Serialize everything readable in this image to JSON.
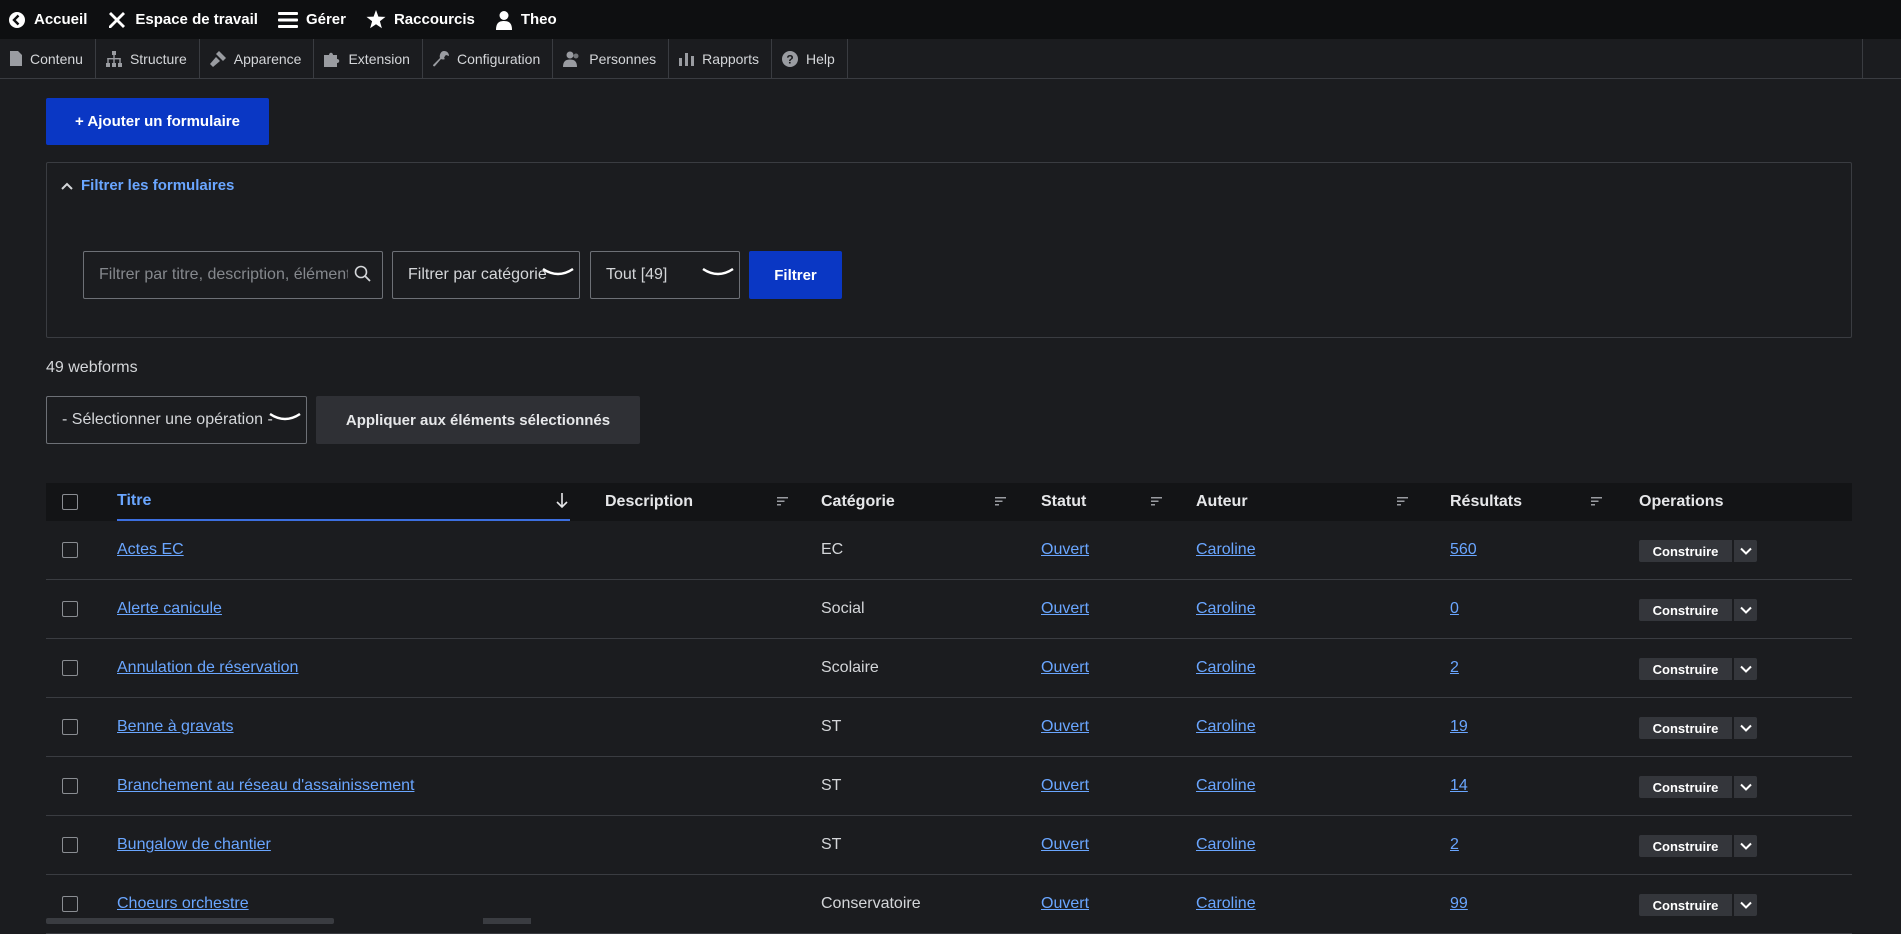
{
  "toolbar": {
    "items": [
      {
        "label": "Accueil",
        "icon": "back-circle-icon"
      },
      {
        "label": "Espace de travail",
        "icon": "tools-icon"
      },
      {
        "label": "Gérer",
        "icon": "menu-icon"
      },
      {
        "label": "Raccourcis",
        "icon": "star-icon"
      },
      {
        "label": "Theo",
        "icon": "user-icon"
      }
    ]
  },
  "admin_menu": {
    "items": [
      {
        "label": "Contenu",
        "icon": "file-icon"
      },
      {
        "label": "Structure",
        "icon": "sitemap-icon"
      },
      {
        "label": "Apparence",
        "icon": "brush-icon"
      },
      {
        "label": "Extension",
        "icon": "puzzle-icon"
      },
      {
        "label": "Configuration",
        "icon": "wrench-icon"
      },
      {
        "label": "Personnes",
        "icon": "people-icon"
      },
      {
        "label": "Rapports",
        "icon": "bar-chart-icon"
      },
      {
        "label": "Help",
        "icon": "question-circle-icon"
      }
    ]
  },
  "add_button": "+ Ajouter un formulaire",
  "filter": {
    "summary": "Filtrer les formulaires",
    "search_placeholder": "Filtrer par titre, description, élément",
    "category_value": "Filtrer par catégorie",
    "state_value": "Tout [49]",
    "submit": "Filtrer"
  },
  "count_text": "49 webforms",
  "bulk": {
    "select_value": "- Sélectionner une opération -",
    "apply": "Appliquer aux éléments sélectionnés"
  },
  "table": {
    "headers": {
      "title": "Titre",
      "description": "Description",
      "category": "Catégorie",
      "status": "Statut",
      "author": "Auteur",
      "results": "Résultats",
      "operations": "Operations"
    },
    "sorted_by": "Titre",
    "rows": [
      {
        "title": "Actes EC",
        "description": "",
        "category": "EC",
        "status": "Ouvert",
        "author": "Caroline",
        "results": "560",
        "op": "Construire"
      },
      {
        "title": "Alerte canicule",
        "description": "",
        "category": "Social",
        "status": "Ouvert",
        "author": "Caroline",
        "results": "0",
        "op": "Construire"
      },
      {
        "title": "Annulation de réservation",
        "description": "",
        "category": "Scolaire",
        "status": "Ouvert",
        "author": "Caroline",
        "results": "2",
        "op": "Construire"
      },
      {
        "title": "Benne à gravats",
        "description": "",
        "category": "ST",
        "status": "Ouvert",
        "author": "Caroline",
        "results": "19",
        "op": "Construire"
      },
      {
        "title": "Branchement au réseau d'assainissement",
        "description": "",
        "category": "ST",
        "status": "Ouvert",
        "author": "Caroline",
        "results": "14",
        "op": "Construire"
      },
      {
        "title": "Bungalow de chantier",
        "description": "",
        "category": "ST",
        "status": "Ouvert",
        "author": "Caroline",
        "results": "2",
        "op": "Construire"
      },
      {
        "title": "Choeurs orchestre",
        "description": "",
        "category": "Conservatoire",
        "status": "Ouvert",
        "author": "Caroline",
        "results": "99",
        "op": "Construire"
      }
    ]
  },
  "colors": {
    "background": "#1b1c1f",
    "toolbar": "#0e0f11",
    "primary_button": "#0a37c4",
    "link": "#6aa6ff"
  }
}
